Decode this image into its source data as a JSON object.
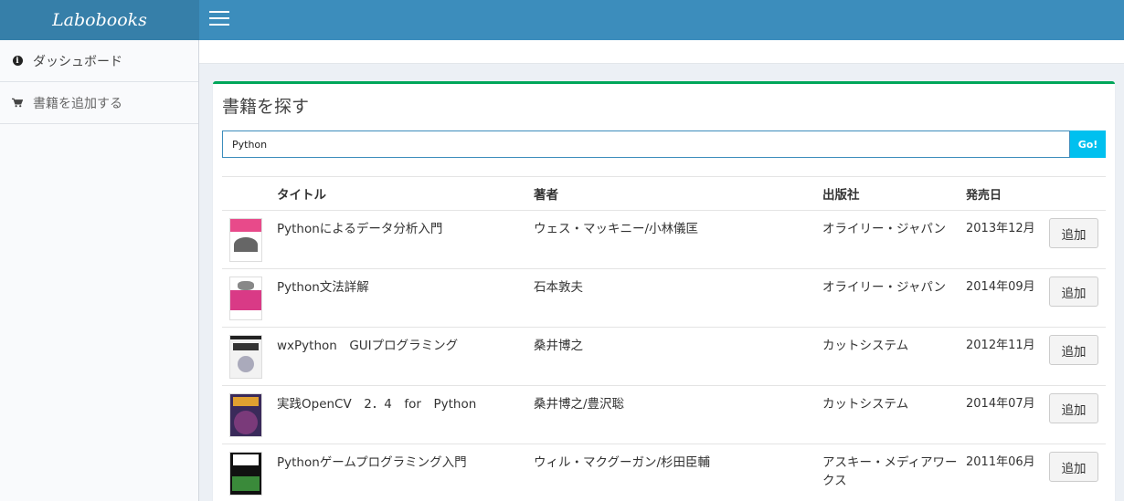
{
  "app": {
    "logo": "Labobooks"
  },
  "sidebar": {
    "items": [
      {
        "label": "ダッシュボード",
        "icon": "info-circle-icon"
      },
      {
        "label": "書籍を追加する",
        "icon": "shopping-cart-icon"
      }
    ]
  },
  "main": {
    "title": "書籍を探す",
    "search": {
      "value": "Python",
      "button": "Go!"
    },
    "columns": [
      "",
      "タイトル",
      "著者",
      "出版社",
      "発売日",
      ""
    ],
    "rows": [
      {
        "title": "Pythonによるデータ分析入門",
        "author": "ウェス・マッキニー/小林儀匡",
        "publisher": "オライリー・ジャパン",
        "date": "2013年12月",
        "action": "追加",
        "cover": "cover-pink"
      },
      {
        "title": "Python文法詳解",
        "author": "石本敦夫",
        "publisher": "オライリー・ジャパン",
        "date": "2014年09月",
        "action": "追加",
        "cover": "cover-magenta"
      },
      {
        "title": "wxPython　GUIプログラミング",
        "author": "桑井博之",
        "publisher": "カットシステム",
        "date": "2012年11月",
        "action": "追加",
        "cover": "cover-white"
      },
      {
        "title": "実践OpenCV　2．4　for　Python",
        "author": "桑井博之/豊沢聡",
        "publisher": "カットシステム",
        "date": "2014年07月",
        "action": "追加",
        "cover": "cover-purple"
      },
      {
        "title": "Pythonゲームプログラミング入門",
        "author": "ウィル・マクグーガン/杉田臣輔",
        "publisher": "アスキー・メディアワークス",
        "date": "2011年06月",
        "action": "追加",
        "cover": "cover-black"
      }
    ]
  },
  "colors": {
    "navbar": "#3c8dbc",
    "logo_bg": "#367fa9",
    "box_border": "#00a65a",
    "go_button": "#00c0ef"
  }
}
